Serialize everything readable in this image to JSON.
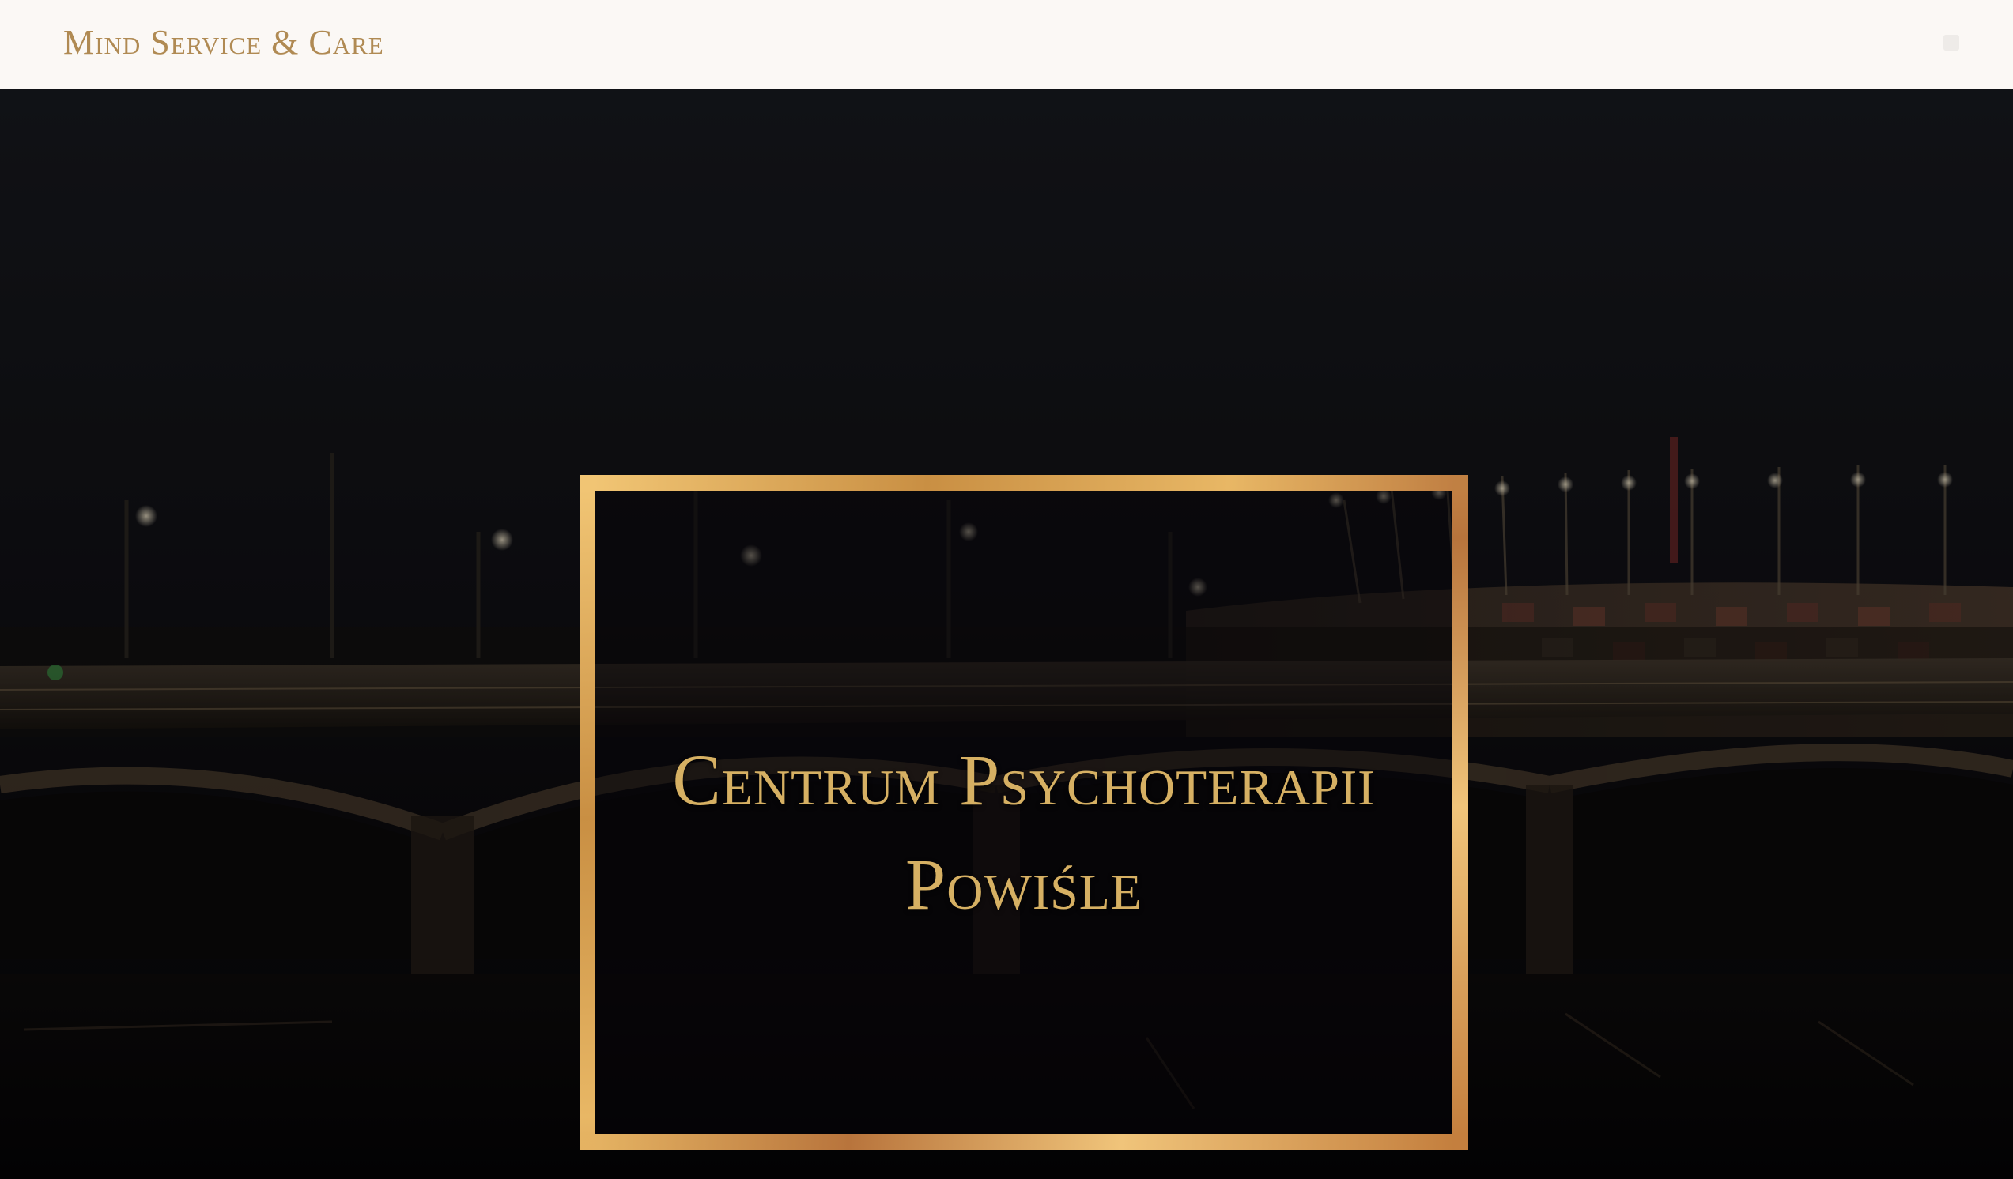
{
  "header": {
    "brand": "Mind Service & Care",
    "menu_icon": "hamburger-menu-icon"
  },
  "hero": {
    "title_line1": "Centrum Psychoterapii",
    "title_line2": "Powiśle",
    "frame_color": "#c99448",
    "title_color": "#d6b063",
    "background_image": "night view of a bridge over a river with an illuminated stadium"
  },
  "colors": {
    "header_bg": "#fbf8f5",
    "brand": "#b08a53"
  }
}
